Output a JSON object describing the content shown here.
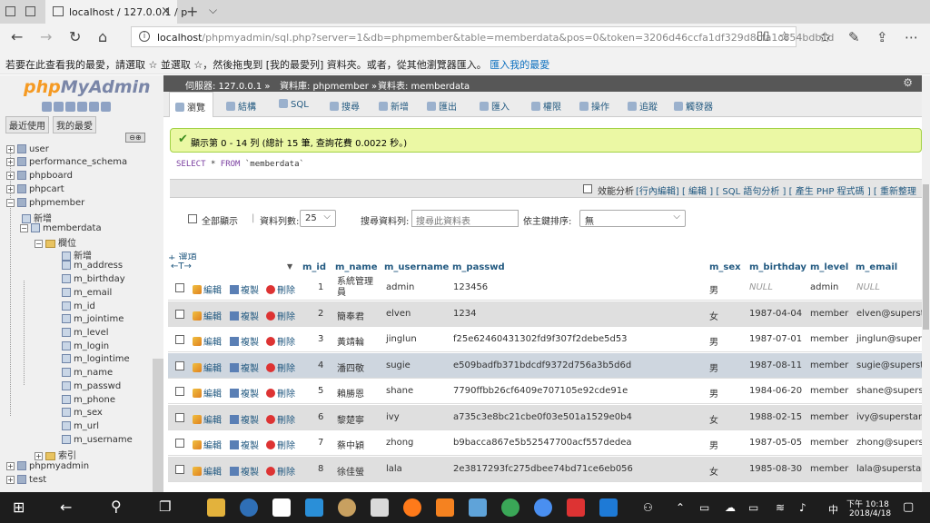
{
  "browser": {
    "tab_title": "localhost / 127.0.0.1 / p",
    "tab_close": "×",
    "new_tab": "+",
    "tab_menu": "⌵",
    "back": "←",
    "forward": "→",
    "refresh": "↻",
    "home": "⌂",
    "url_host": "localhost",
    "url_rest": "/phpmyadmin/sql.php?server=1&db=phpmember&table=memberdata&pos=0&token=3206d46ccfa1df329d8cfa1c654bdb1d",
    "reading_view": "▯▯",
    "favorite_star": "☆",
    "favorites_hub": "✩",
    "pen": "✎",
    "share": "⇪",
    "more": "⋯",
    "favbar_msg": "若要在此查看我的最愛，請選取 ☆ 並選取 ☆，然後拖曳到 [我的最愛列] 資料夾。或者，從其他瀏覽器匯入。",
    "favbar_link": "匯入我的最愛"
  },
  "sidebar": {
    "logo_php": "php",
    "logo_myadmin": "MyAdmin",
    "tab_recent": "最近使用",
    "tab_favorites": "我的最愛",
    "collapse_btn": "⊖⊕",
    "databases": [
      "user",
      "performance_schema",
      "phpboard",
      "phpcart",
      "phpmember"
    ],
    "phpmember_new": "新增",
    "table": "memberdata",
    "columns_folder": "欄位",
    "columns_new": "新增",
    "columns": [
      "m_address",
      "m_birthday",
      "m_email",
      "m_id",
      "m_jointime",
      "m_level",
      "m_login",
      "m_logintime",
      "m_name",
      "m_passwd",
      "m_phone",
      "m_sex",
      "m_url",
      "m_username"
    ],
    "indexes_folder": "索引",
    "databases_after": [
      "phpmyadmin",
      "test"
    ]
  },
  "breadcrumb": {
    "server": "伺服器: 127.0.0.1 »",
    "database": "資料庫: phpmember »",
    "table": "資料表: memberdata",
    "gear": "⚙"
  },
  "tabs": [
    "瀏覽",
    "結構",
    "SQL",
    "搜尋",
    "新增",
    "匯出",
    "匯入",
    "權限",
    "操作",
    "追蹤",
    "觸發器"
  ],
  "message": {
    "text": "顯示第 0 - 14 列 (總計 15 筆, 查詢花費 0.0022 秒。)"
  },
  "sql": {
    "select": "SELECT",
    "star": "*",
    "from": "FROM",
    "table": "`memberdata`"
  },
  "profiling": {
    "label": "效能分析",
    "links": "[行內編輯] [ 編輯 ] [ SQL 語句分析 ] [ 產生 PHP 程式碼 ] [ 重新整理"
  },
  "nav": {
    "show_all": "全部顯示",
    "rows_label": "資料列數:",
    "rows_value": "25",
    "filter_label": "搜尋資料列:",
    "filter_placeholder": "搜尋此資料表",
    "sort_label": "依主鍵排序:",
    "sort_value": "無"
  },
  "table": {
    "add_options": "+ 選項",
    "arrows": "←T→",
    "columns": [
      "m_id",
      "m_name",
      "m_username",
      "m_passwd",
      "m_sex",
      "m_birthday",
      "m_level",
      "m_email"
    ],
    "actions": {
      "edit": "編輯",
      "copy": "複製",
      "delete": "刪除"
    },
    "rows": [
      {
        "id": "1",
        "name": "系統管理員",
        "username": "admin",
        "passwd": "123456",
        "sex": "男",
        "birthday": "NULL",
        "level": "admin",
        "email": "NULL"
      },
      {
        "id": "2",
        "name": "簡奉君",
        "username": "elven",
        "passwd": "1234",
        "sex": "女",
        "birthday": "1987-04-04",
        "level": "member",
        "email": "elven@supersta"
      },
      {
        "id": "3",
        "name": "黃靖輪",
        "username": "jinglun",
        "passwd": "f25e62460431302fd9f307f2debe5d53",
        "sex": "男",
        "birthday": "1987-07-01",
        "level": "member",
        "email": "jinglun@superst"
      },
      {
        "id": "4",
        "name": "潘四敬",
        "username": "sugie",
        "passwd": "e509badfb371bdcdf9372d756a3b5d6d",
        "sex": "男",
        "birthday": "1987-08-11",
        "level": "member",
        "email": "sugie@supersta"
      },
      {
        "id": "5",
        "name": "賴勝恩",
        "username": "shane",
        "passwd": "7790ffbb26cf6409e707105e92cde91e",
        "sex": "男",
        "birthday": "1984-06-20",
        "level": "member",
        "email": "shane@superst"
      },
      {
        "id": "6",
        "name": "黎楚寧",
        "username": "ivy",
        "passwd": "a735c3e8bc21cbe0f03e501a1529e0b4",
        "sex": "女",
        "birthday": "1988-02-15",
        "level": "member",
        "email": "ivy@superstar.c"
      },
      {
        "id": "7",
        "name": "蔡中穎",
        "username": "zhong",
        "passwd": "b9bacca867e5b52547700acf557dedea",
        "sex": "男",
        "birthday": "1987-05-05",
        "level": "member",
        "email": "zhong@superstar"
      },
      {
        "id": "8",
        "name": "徐佳螢",
        "username": "lala",
        "passwd": "2e3817293fc275dbee74bd71ce6eb056",
        "sex": "女",
        "birthday": "1985-08-30",
        "level": "member",
        "email": "lala@superstar."
      }
    ]
  },
  "taskbar": {
    "time": "下午 10:18",
    "date": "2018/4/18",
    "ime": "中"
  }
}
